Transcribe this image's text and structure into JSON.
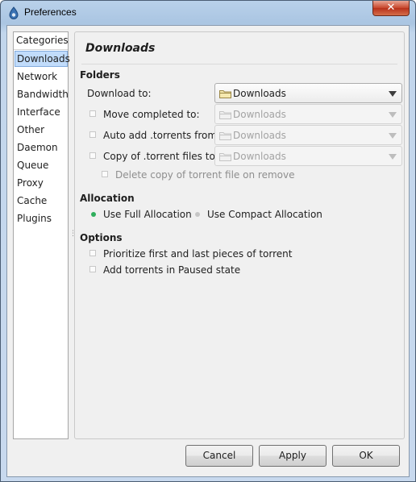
{
  "window": {
    "title": "Preferences",
    "close_label": "✕"
  },
  "categories": {
    "header": "Categories",
    "items": [
      {
        "label": "Downloads",
        "selected": true
      },
      {
        "label": "Network"
      },
      {
        "label": "Bandwidth"
      },
      {
        "label": "Interface"
      },
      {
        "label": "Other"
      },
      {
        "label": "Daemon"
      },
      {
        "label": "Queue"
      },
      {
        "label": "Proxy"
      },
      {
        "label": "Cache"
      },
      {
        "label": "Plugins"
      }
    ]
  },
  "downloads": {
    "title": "Downloads",
    "folders": {
      "heading": "Folders",
      "download_to": {
        "label": "Download to:",
        "value": "Downloads"
      },
      "move_completed": {
        "label": "Move completed to:",
        "value": "Downloads",
        "checked": false
      },
      "auto_add": {
        "label": "Auto add .torrents from:",
        "value": "Downloads",
        "checked": false
      },
      "copy_torrent": {
        "label": "Copy of .torrent files to:",
        "value": "Downloads",
        "checked": false
      },
      "delete_copy": {
        "label": "Delete copy of torrent file on remove",
        "checked": false
      }
    },
    "allocation": {
      "heading": "Allocation",
      "full": {
        "label": "Use Full Allocation",
        "selected": true
      },
      "compact": {
        "label": "Use Compact Allocation",
        "selected": false
      }
    },
    "options": {
      "heading": "Options",
      "prioritize": {
        "label": "Prioritize first and last pieces of torrent",
        "checked": false
      },
      "paused": {
        "label": "Add torrents in Paused state",
        "checked": false
      }
    }
  },
  "buttons": {
    "cancel": "Cancel",
    "apply": "Apply",
    "ok": "OK"
  },
  "colors": {
    "selection": "#c1dcfb",
    "radio_active": "#2fae5c",
    "radio_inactive": "#c6c6c6",
    "close": "#c7452b"
  }
}
